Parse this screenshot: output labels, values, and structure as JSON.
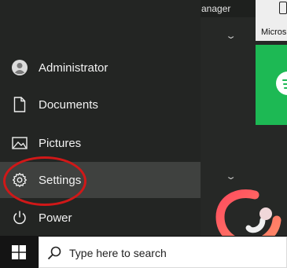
{
  "background": {
    "window_title_fragment": "anager",
    "tile_label_fragment": "Micros",
    "tile_icon": "spotify-icon"
  },
  "start_menu": {
    "items": [
      {
        "label": "Administrator",
        "icon": "user-avatar-icon"
      },
      {
        "label": "Documents",
        "icon": "document-icon"
      },
      {
        "label": "Pictures",
        "icon": "picture-icon"
      },
      {
        "label": "Settings",
        "icon": "gear-icon",
        "highlighted": true
      },
      {
        "label": "Power",
        "icon": "power-icon"
      }
    ]
  },
  "taskbar": {
    "start_icon": "windows-logo-icon",
    "search_placeholder": "Type here to search"
  },
  "colors": {
    "annotation_ring": "#d01818",
    "spotify_green": "#1db954",
    "logo_gradient_start": "#ff4d5e",
    "logo_gradient_end": "#ff8c69"
  }
}
